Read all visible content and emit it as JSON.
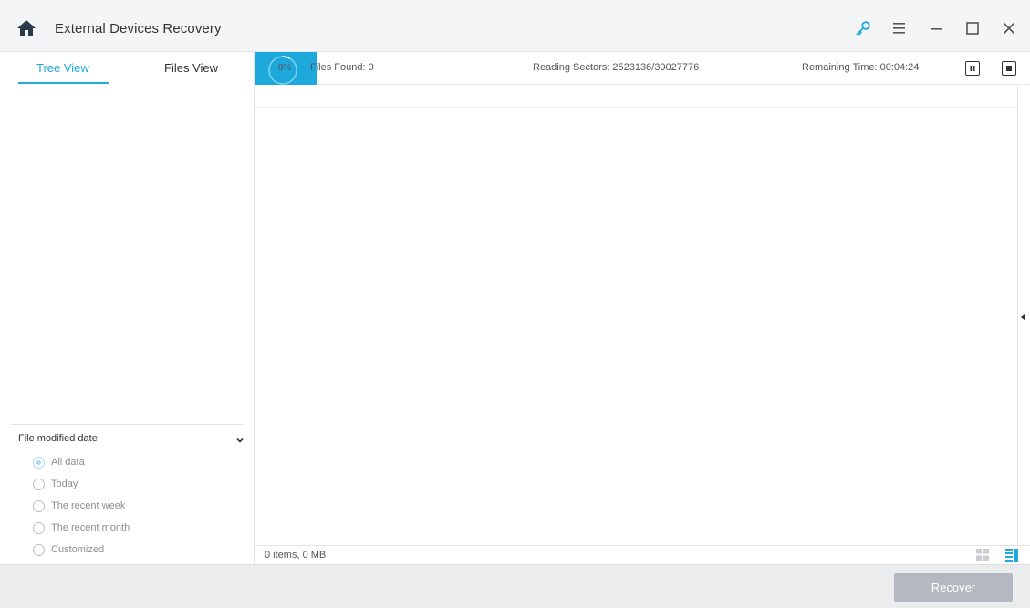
{
  "window": {
    "title": "External Devices Recovery",
    "icons": [
      "home-icon",
      "key-icon",
      "menu-icon",
      "minimize-icon",
      "maximize-icon",
      "close-icon"
    ],
    "accent_color": "#1ea9dd"
  },
  "sidebar": {
    "tabs": [
      {
        "label": "Tree View",
        "active": true
      },
      {
        "label": "Files View",
        "active": false
      }
    ],
    "filter": {
      "title": "File modified date",
      "options": [
        {
          "label": "All data",
          "selected": true
        },
        {
          "label": "Today",
          "selected": false
        },
        {
          "label": "The recent week",
          "selected": false
        },
        {
          "label": "The recent month",
          "selected": false
        },
        {
          "label": "Customized",
          "selected": false
        }
      ]
    }
  },
  "scan": {
    "progress_label": "8%",
    "progress_fraction": 0.08,
    "files_found": "Files Found:  0",
    "reading_sectors": "Reading Sectors:  2523136/30027776",
    "remaining_time": "Remaining Time: 00:04:24"
  },
  "status": {
    "summary": "0 items, 0 MB"
  },
  "footer": {
    "recover_label": "Recover"
  }
}
